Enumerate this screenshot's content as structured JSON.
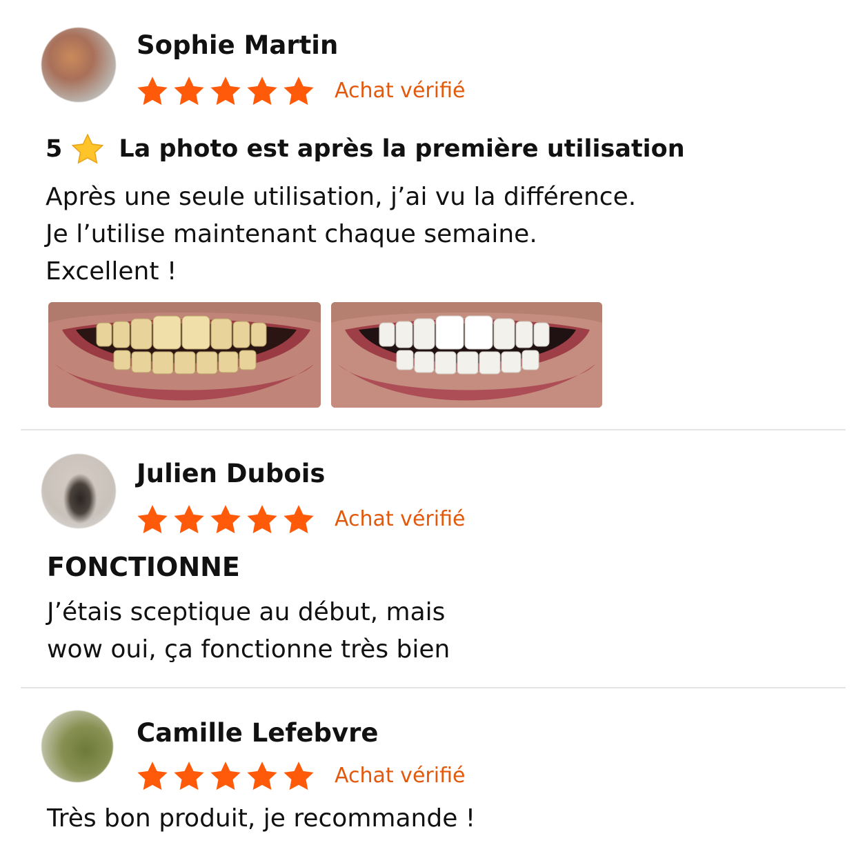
{
  "reviews": [
    {
      "author": "Sophie Martin",
      "rating": 5,
      "verified_label": "Achat vérifié",
      "title_rating": "5",
      "title": "La photo est après la première utilisation",
      "body": "Après une seule utilisation, j’ai vu la différence.\nJe l’utilise maintenant chaque semaine.\nExcellent !",
      "photos": [
        "before-smile-photo",
        "after-smile-photo"
      ]
    },
    {
      "author": "Julien Dubois",
      "rating": 5,
      "verified_label": "Achat vérifié",
      "title": "FONCTIONNE",
      "body": "J’étais sceptique au début, mais\nwow oui, ça fonctionne très bien"
    },
    {
      "author": "Camille Lefebvre",
      "rating": 5,
      "verified_label": "Achat vérifié",
      "body": "Très bon produit, je recommande !"
    }
  ],
  "colors": {
    "star": "#ff5a0a",
    "verified": "#e2590c",
    "divider": "#e4e4e4",
    "text": "#111111"
  },
  "icons": {
    "rating_star": "star-icon",
    "title_star": "star-emoji-icon"
  }
}
